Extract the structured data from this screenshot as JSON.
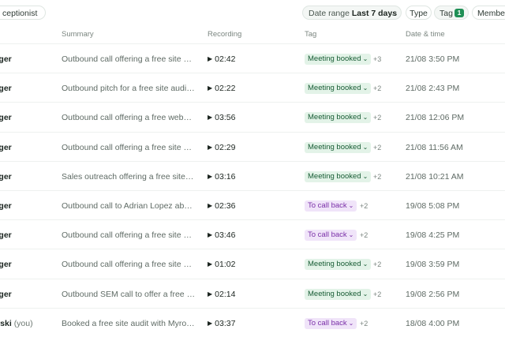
{
  "filters": {
    "receptionist": "ceptionist",
    "date_range_label": "Date range",
    "date_range_value": "Last 7 days",
    "type_label": "Type",
    "tag_label": "Tag",
    "tag_count": "1",
    "members_label": "Members"
  },
  "columns": {
    "summary": "Summary",
    "recording": "Recording",
    "tag": "Tag",
    "datetime": "Date & time"
  },
  "colors": {
    "meeting_booked": "#e3f3e8",
    "to_call_back": "#f0e4f9",
    "accent": "#1f8f55"
  },
  "rows": [
    {
      "owner": "nger",
      "you": "",
      "summary": "Outbound call offering a free site au…",
      "recording": "02:42",
      "tag": "Meeting booked",
      "tag_kind": "green",
      "more": "+3",
      "datetime": "21/08 3:50 PM"
    },
    {
      "owner": "nger",
      "you": "",
      "summary": "Outbound pitch for a free site audit t…",
      "recording": "02:22",
      "tag": "Meeting booked",
      "tag_kind": "green",
      "more": "+2",
      "datetime": "21/08 2:43 PM"
    },
    {
      "owner": "nger",
      "you": "",
      "summary": "Outbound call offering a free websit…",
      "recording": "03:56",
      "tag": "Meeting booked",
      "tag_kind": "green",
      "more": "+2",
      "datetime": "21/08 12:06 PM"
    },
    {
      "owner": "nger",
      "you": "",
      "summary": "Outbound call offering a free site au…",
      "recording": "02:29",
      "tag": "Meeting booked",
      "tag_kind": "green",
      "more": "+2",
      "datetime": "21/08 11:56 AM"
    },
    {
      "owner": "nger",
      "you": "",
      "summary": "Sales outreach offering a free site a…",
      "recording": "03:16",
      "tag": "Meeting booked",
      "tag_kind": "green",
      "more": "+2",
      "datetime": "21/08 10:21 AM"
    },
    {
      "owner": "nger",
      "you": "",
      "summary": "Outbound call to Adrian Lopez about…",
      "recording": "02:36",
      "tag": "To call back",
      "tag_kind": "purple",
      "more": "+2",
      "datetime": "19/08 5:08 PM"
    },
    {
      "owner": "nger",
      "you": "",
      "summary": "Outbound call offering a free site au…",
      "recording": "03:46",
      "tag": "To call back",
      "tag_kind": "purple",
      "more": "+2",
      "datetime": "19/08 4:25 PM"
    },
    {
      "owner": "nger",
      "you": "",
      "summary": "Outbound call offering a free site au…",
      "recording": "01:02",
      "tag": "Meeting booked",
      "tag_kind": "green",
      "more": "+2",
      "datetime": "19/08 3:59 PM"
    },
    {
      "owner": "nger",
      "you": "",
      "summary": "Outbound SEM call to offer a free sit…",
      "recording": "02:14",
      "tag": "Meeting booked",
      "tag_kind": "green",
      "more": "+2",
      "datetime": "19/08 2:56 PM"
    },
    {
      "owner": "wski",
      "you": "(you)",
      "summary": "Booked a free site audit with Myron …",
      "recording": "03:37",
      "tag": "To call back",
      "tag_kind": "purple",
      "more": "+2",
      "datetime": "18/08 4:00 PM"
    }
  ]
}
